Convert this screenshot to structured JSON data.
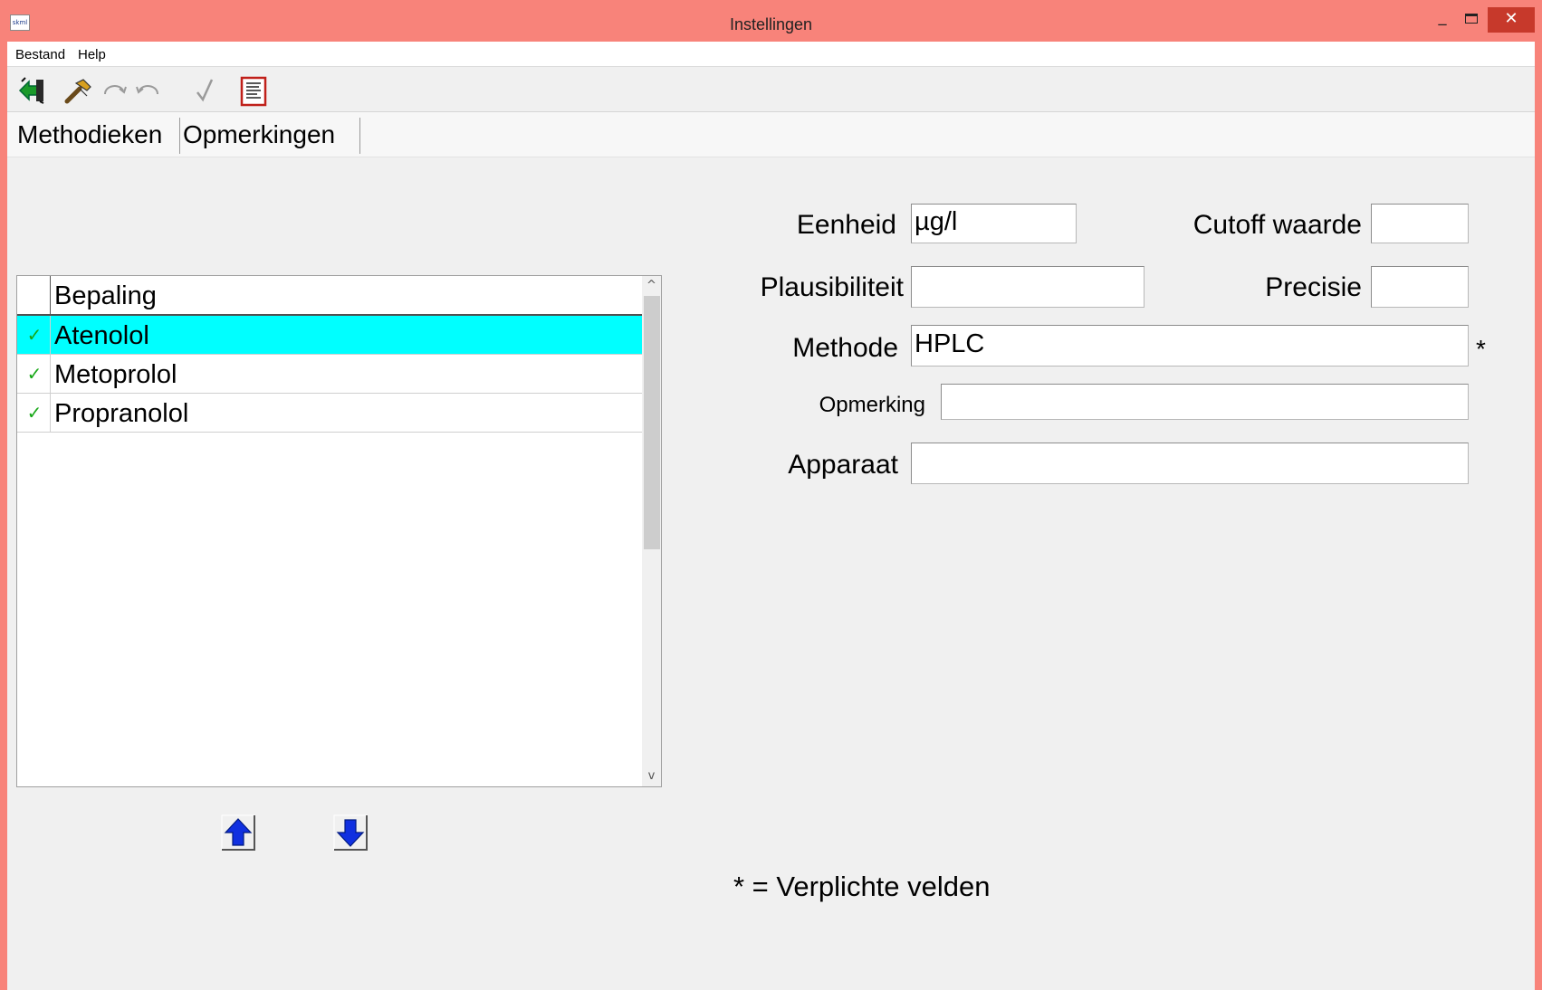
{
  "window": {
    "title": "Instellingen",
    "app_icon_text": "skml",
    "minimize": "_",
    "close": "✕"
  },
  "menu": {
    "items": [
      {
        "label": "Bestand"
      },
      {
        "label": "Help"
      }
    ]
  },
  "toolbar": {
    "buttons": [
      {
        "icon": "exit-icon"
      },
      {
        "icon": "hammer-icon"
      },
      {
        "icon": "redo-icon"
      },
      {
        "icon": "undo-icon"
      },
      {
        "icon": "checkmark-icon"
      },
      {
        "icon": "document-icon"
      }
    ]
  },
  "tabs": [
    {
      "label": "Methodieken",
      "active": true
    },
    {
      "label": "Opmerkingen",
      "active": false
    }
  ],
  "grid": {
    "column_header": "Bepaling",
    "rows": [
      {
        "label": "Atenolol",
        "checked": true,
        "selected": true
      },
      {
        "label": "Metoprolol",
        "checked": true,
        "selected": false
      },
      {
        "label": "Propranolol",
        "checked": true,
        "selected": false
      }
    ],
    "check_glyph": "✓",
    "scroll_up": "^",
    "scroll_down": "v"
  },
  "form": {
    "eenheid": {
      "label": "Eenheid",
      "value": "µg/l"
    },
    "cutoff": {
      "label": "Cutoff waarde",
      "value": ""
    },
    "plausibiliteit": {
      "label": "Plausibiliteit",
      "value": ""
    },
    "precisie": {
      "label": "Precisie",
      "value": ""
    },
    "methode": {
      "label": "Methode",
      "value": "HPLC",
      "required_marker": "*"
    },
    "opmerking": {
      "label": "Opmerking",
      "value": ""
    },
    "apparaat": {
      "label": "Apparaat",
      "value": ""
    }
  },
  "required_note": "* = Verplichte velden",
  "colors": {
    "titlebar": "#f8837a",
    "close_button": "#c7392b",
    "selected_row": "#00ffff",
    "check": "#18a818",
    "arrow_blue": "#1030e0"
  }
}
